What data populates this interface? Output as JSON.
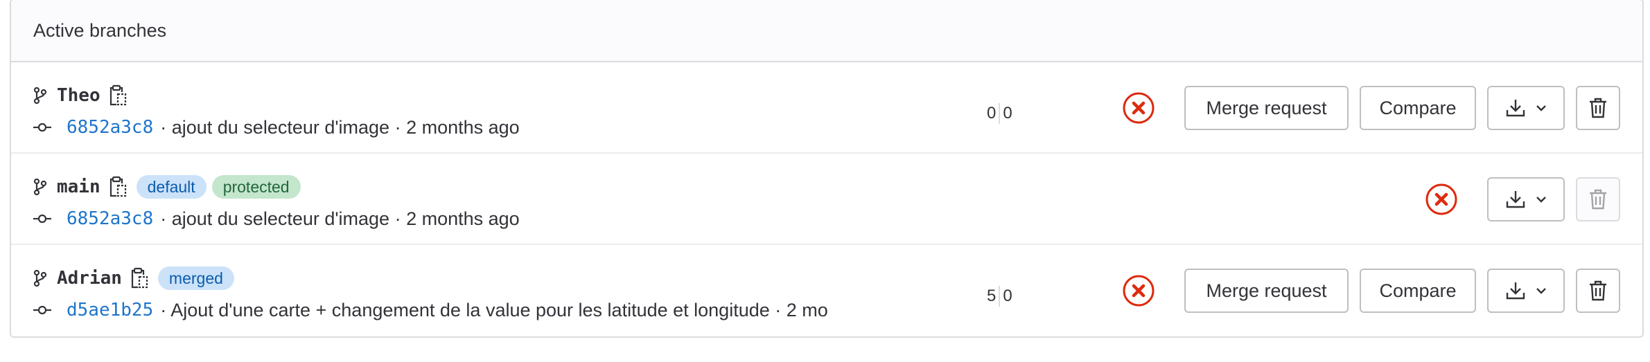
{
  "header": {
    "title": "Active branches"
  },
  "branches": [
    {
      "name": "Theo",
      "badges": [],
      "sha": "6852a3c8",
      "commit_text": "· ajout du selecteur d'image · 2 months ago",
      "behind": "0",
      "ahead": "0",
      "merge_request_label": "Merge request",
      "compare_label": "Compare",
      "delete_disabled": false
    },
    {
      "name": "main",
      "badges": [
        "default",
        "protected"
      ],
      "sha": "6852a3c8",
      "commit_text": "· ajout du selecteur d'image · 2 months ago",
      "delete_disabled": true
    },
    {
      "name": "Adrian",
      "badges": [
        "merged"
      ],
      "sha": "d5ae1b25",
      "commit_text": "· Ajout d'une carte + changement de la value pour les latitude et longitude · 2 mo",
      "behind": "5",
      "ahead": "0",
      "merge_request_label": "Merge request",
      "compare_label": "Compare",
      "delete_disabled": false
    }
  ],
  "colors": {
    "status_failed": "#dd2b0e",
    "link": "#1f75cb",
    "badge_info_bg": "#cbe2f9",
    "badge_success_bg": "#c3e6cd"
  },
  "icons": {
    "branch": "branch-icon",
    "copy": "copy-to-clipboard-icon",
    "commit": "commit-icon",
    "status": "status-failed-icon",
    "download": "download-icon",
    "chevron": "chevron-down-icon",
    "delete": "trash-icon"
  }
}
